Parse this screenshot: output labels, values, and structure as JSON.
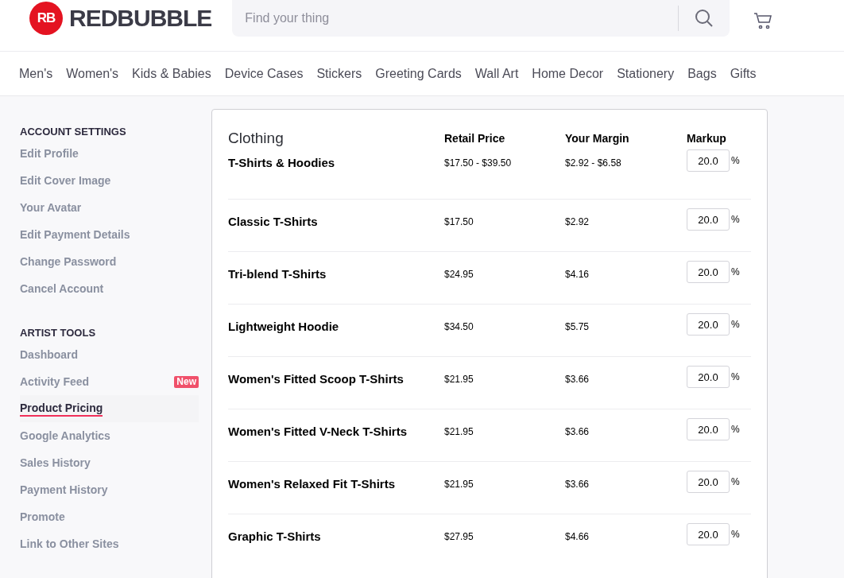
{
  "header": {
    "logo_mark": "RB",
    "logo_text": "REDBUBBLE",
    "search": {
      "placeholder": "Find your thing"
    }
  },
  "nav": [
    "Men's",
    "Women's",
    "Kids & Babies",
    "Device Cases",
    "Stickers",
    "Greeting Cards",
    "Wall Art",
    "Home Decor",
    "Stationery",
    "Bags",
    "Gifts"
  ],
  "sidebar": [
    {
      "heading": "ACCOUNT SETTINGS",
      "items": [
        {
          "label": "Edit Profile",
          "selected": false
        },
        {
          "label": "Edit Cover Image",
          "selected": false
        },
        {
          "label": "Your Avatar",
          "selected": false
        },
        {
          "label": "Edit Payment Details",
          "selected": false
        },
        {
          "label": "Change Password",
          "selected": false
        },
        {
          "label": "Cancel Account",
          "selected": false
        }
      ]
    },
    {
      "heading": "ARTIST TOOLS",
      "items": [
        {
          "label": "Dashboard",
          "selected": false
        },
        {
          "label": "Activity Feed",
          "selected": false,
          "badge": "New"
        },
        {
          "label": "Product Pricing",
          "selected": true
        },
        {
          "label": "Google Analytics",
          "selected": false
        },
        {
          "label": "Sales History",
          "selected": false
        },
        {
          "label": "Payment History",
          "selected": false
        },
        {
          "label": "Promote",
          "selected": false
        },
        {
          "label": "Link to Other Sites",
          "selected": false
        }
      ]
    }
  ],
  "pricing": {
    "title": "Clothing",
    "columns": [
      "Retail Price",
      "Your Margin",
      "Markup"
    ],
    "unit": "%",
    "rows": [
      {
        "product": "T-Shirts & Hoodies",
        "retail": "$17.50 - $39.50",
        "margin": "$2.92 - $6.58",
        "markup": "20.0"
      },
      {
        "product": "Classic T-Shirts",
        "retail": "$17.50",
        "margin": "$2.92",
        "markup": "20.0"
      },
      {
        "product": "Tri-blend T-Shirts",
        "retail": "$24.95",
        "margin": "$4.16",
        "markup": "20.0"
      },
      {
        "product": "Lightweight Hoodie",
        "retail": "$34.50",
        "margin": "$5.75",
        "markup": "20.0"
      },
      {
        "product": "Women's Fitted Scoop T-Shirts",
        "retail": "$21.95",
        "margin": "$3.66",
        "markup": "20.0"
      },
      {
        "product": "Women's Fitted V-Neck T-Shirts",
        "retail": "$21.95",
        "margin": "$3.66",
        "markup": "20.0"
      },
      {
        "product": "Women's Relaxed Fit T-Shirts",
        "retail": "$21.95",
        "margin": "$3.66",
        "markup": "20.0"
      },
      {
        "product": "Graphic T-Shirts",
        "retail": "$27.95",
        "margin": "$4.66",
        "markup": "20.0"
      }
    ]
  }
}
